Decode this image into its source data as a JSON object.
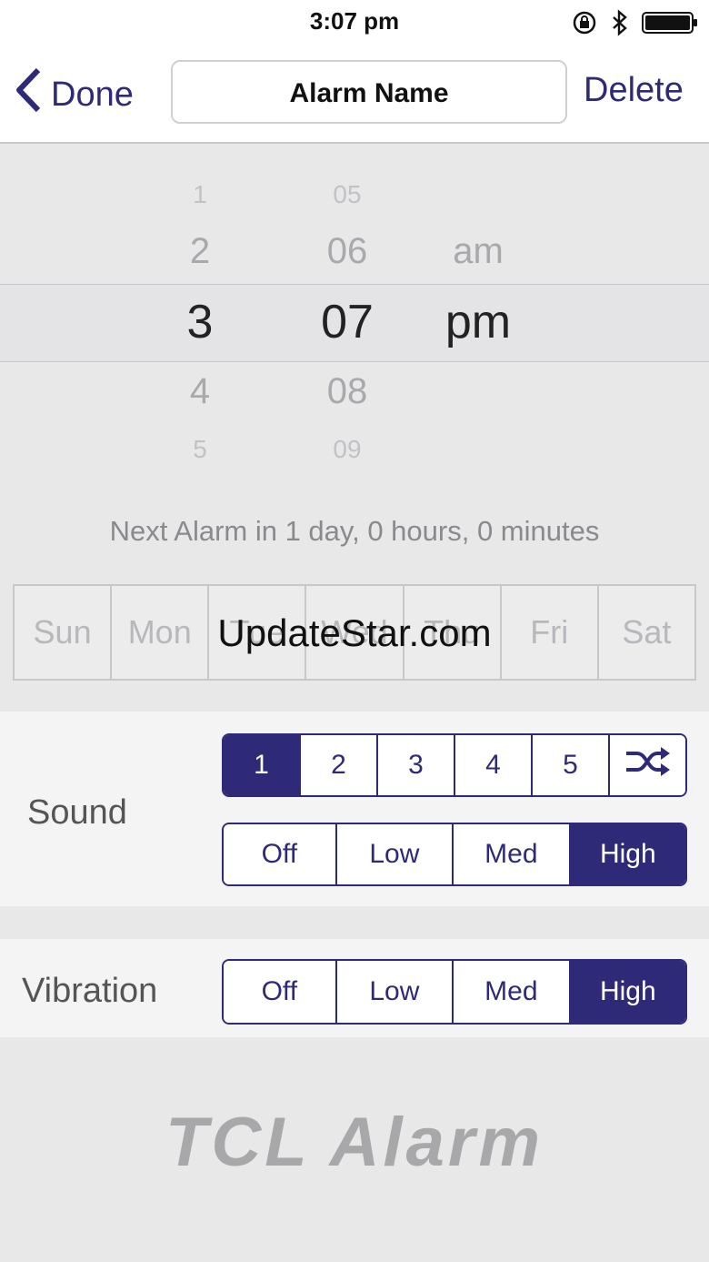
{
  "status_bar": {
    "time": "3:07 pm",
    "icons": [
      "rotation-lock-icon",
      "bluetooth-icon",
      "battery-icon"
    ]
  },
  "nav": {
    "back_label": "Done",
    "alarm_name": "Alarm Name",
    "delete_label": "Delete"
  },
  "picker": {
    "hours": [
      "1",
      "2",
      "3",
      "4",
      "5"
    ],
    "minutes": [
      "05",
      "06",
      "07",
      "08",
      "09"
    ],
    "ampm": [
      "am",
      "pm"
    ],
    "selected": {
      "hour": "3",
      "minute": "07",
      "ampm": "pm"
    }
  },
  "next_alarm_text": "Next Alarm in 1 day, 0 hours, 0 minutes",
  "days": [
    "Sun",
    "Mon",
    "Tue",
    "Wed",
    "Thu",
    "Fri",
    "Sat"
  ],
  "watermark": "UpdateStar.com",
  "sound": {
    "label": "Sound",
    "tones": [
      "1",
      "2",
      "3",
      "4",
      "5"
    ],
    "selected_tone": "1",
    "shuffle_icon": "shuffle-icon",
    "levels": [
      "Off",
      "Low",
      "Med",
      "High"
    ],
    "selected_level": "High"
  },
  "vibration": {
    "label": "Vibration",
    "levels": [
      "Off",
      "Low",
      "Med",
      "High"
    ],
    "selected_level": "High"
  },
  "logo_text": "TCL Alarm",
  "colors": {
    "accent": "#2e2a78",
    "background": "#e8e8e9",
    "panel": "#f4f4f5"
  }
}
